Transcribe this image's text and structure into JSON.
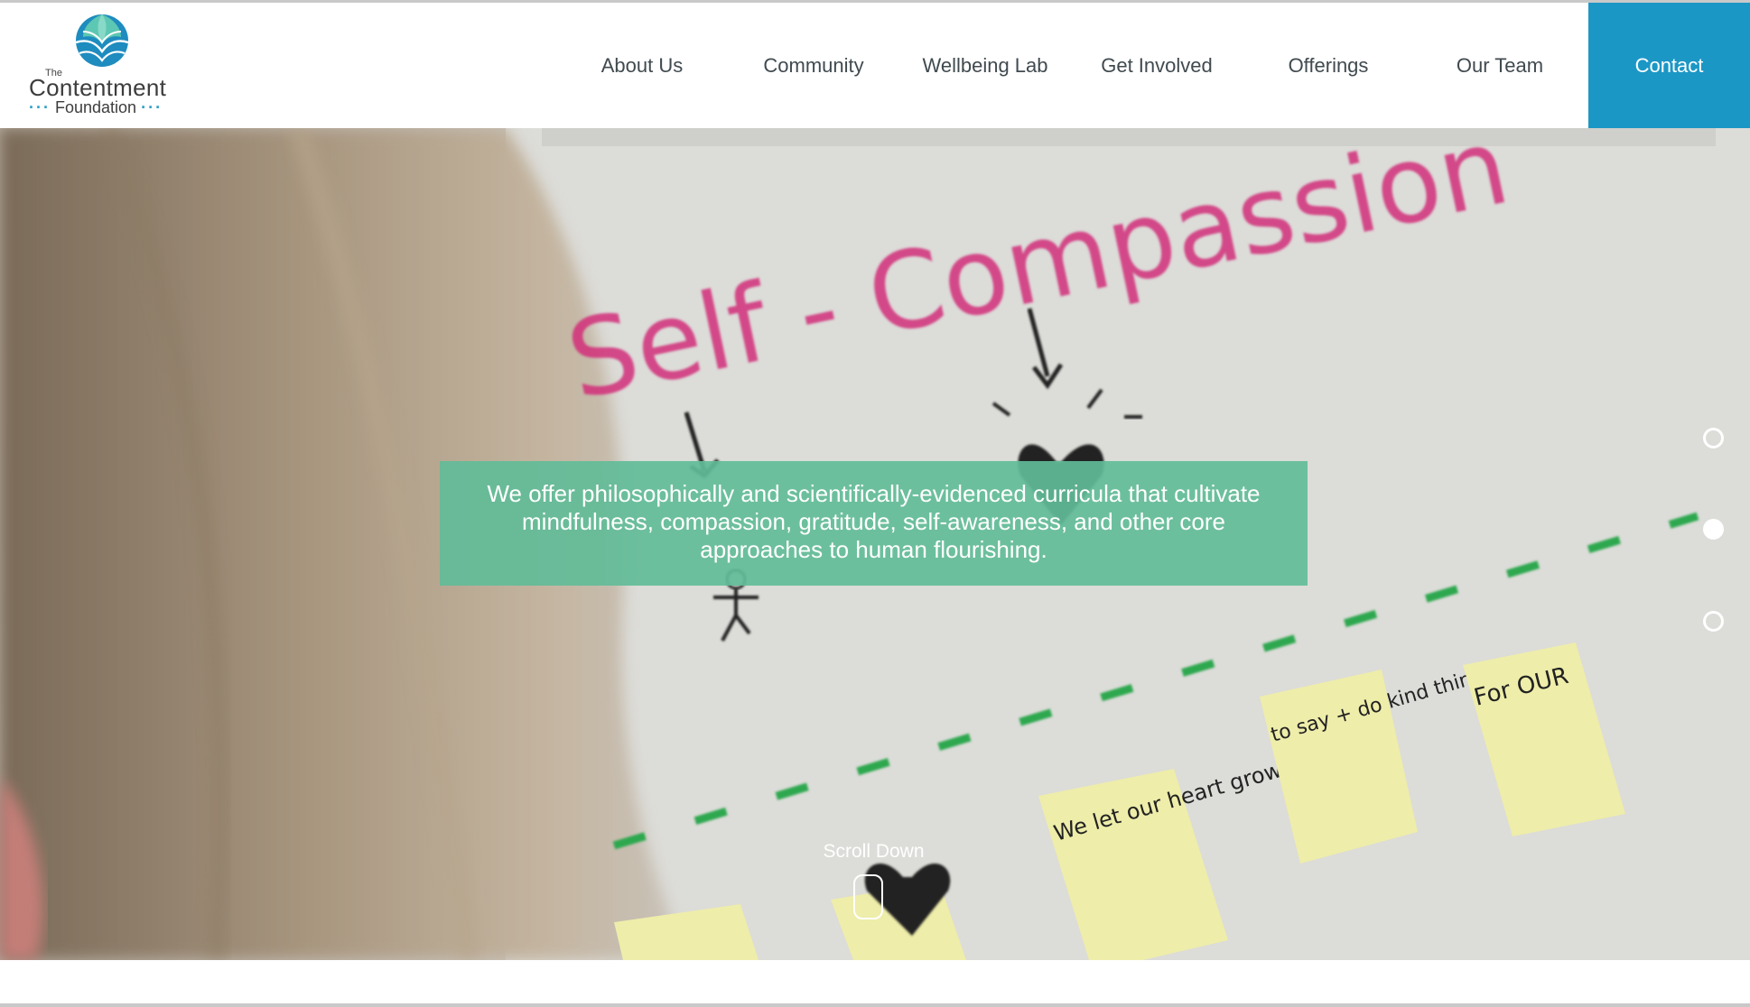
{
  "logo": {
    "the": "The",
    "name": "Contentment",
    "sub_dots_left": "···",
    "sub_text": "Foundation",
    "sub_dots_right": "···"
  },
  "nav": {
    "items": [
      {
        "label": "About Us"
      },
      {
        "label": "Community"
      },
      {
        "label": "Wellbeing Lab"
      },
      {
        "label": "Get Involved"
      },
      {
        "label": "Offerings"
      },
      {
        "label": "Our Team"
      }
    ],
    "contact": "Contact"
  },
  "hero": {
    "image_text": {
      "poster_heading": "Self - Compassion",
      "note_1": "We let our heart grow really big",
      "note_2": "to say + do kind things",
      "note_3": "For OUR"
    },
    "banner_text": "We offer philosophically and scientifically-evidenced curricula that cultivate mindfulness, compassion, gratitude, self-awareness, and other core approaches to human flourishing.",
    "scroll_label": "Scroll Down",
    "slide_active_index": 1
  },
  "colors": {
    "accent_blue": "#1b97c6",
    "banner_green": "#62bc98",
    "nav_text": "#404a4f",
    "poster_pink": "#d2317b",
    "dash_green": "#2fa84f",
    "sticky_yellow": "#eeedaa"
  },
  "icons": {
    "logo_mark": "lotus-globe-icon",
    "scroll": "mouse-icon",
    "slider": "slide-dot-icon"
  }
}
